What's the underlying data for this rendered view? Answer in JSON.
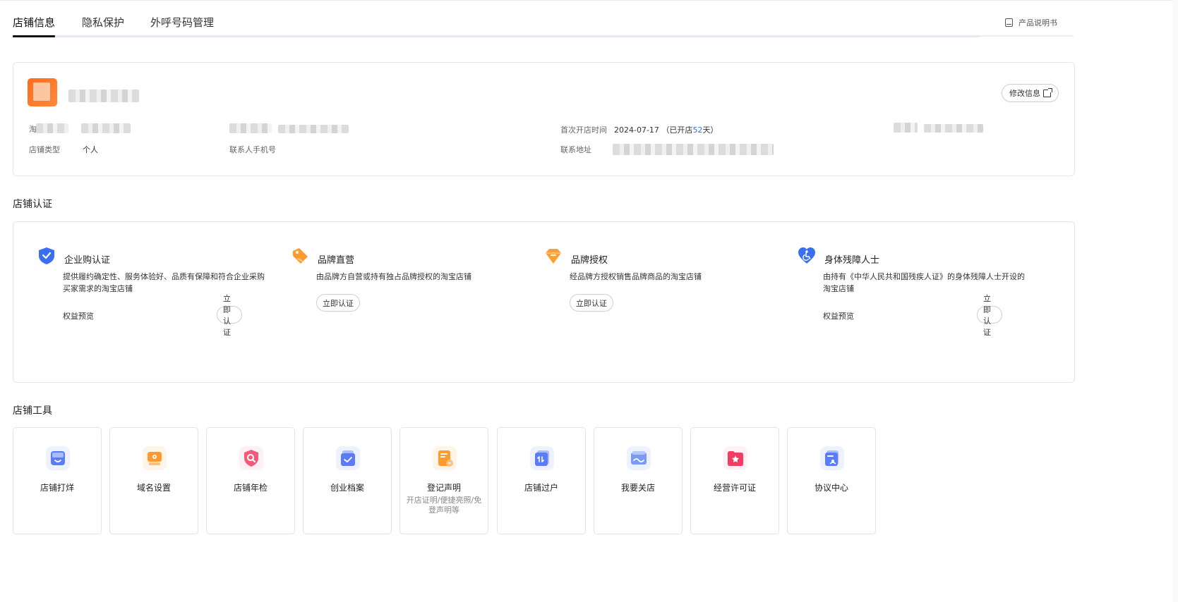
{
  "tabs": [
    {
      "label": "店铺信息",
      "active": true
    },
    {
      "label": "隐私保护",
      "active": false
    },
    {
      "label": "外呼号码管理",
      "active": false
    }
  ],
  "manual_link": "产品说明书",
  "shop_info": {
    "edit_button": "修改信息",
    "first_open_label": "首次开店时间",
    "first_open_date": "2024-07-17",
    "open_prefix": "（已开店",
    "open_days": "52",
    "open_suffix": "天）",
    "shop_type_label": "店铺类型",
    "shop_type_value": "个人",
    "contact_phone_label": "联系人手机号",
    "address_label": "联系地址",
    "partial_label": "淘"
  },
  "cert_section_title": "店铺认证",
  "certs": [
    {
      "title": "企业购认证",
      "desc": "提供履约确定性、服务体验好、品质有保障和符合企业采购买家需求的淘宝店铺",
      "benefit": "权益预览",
      "button": "立即认证",
      "icon": "shield-check-icon"
    },
    {
      "title": "品牌直营",
      "desc": "由品牌方自营或持有独占品牌授权的淘宝店铺",
      "button": "立即认证",
      "icon": "price-tag-icon"
    },
    {
      "title": "品牌授权",
      "desc": "经品牌方授权销售品牌商品的淘宝店铺",
      "button": "立即认证",
      "icon": "diamond-icon"
    },
    {
      "title": "身体残障人士",
      "desc": "由持有《中华人民共和国残疾人证》的身体残障人士开设的淘宝店铺",
      "benefit": "权益预览",
      "button": "立即认证",
      "icon": "heart-wheelchair-icon"
    }
  ],
  "tools_section_title": "店铺工具",
  "tools": [
    {
      "label": "店铺打烊",
      "icon": "store-closed-icon",
      "color": "#5b7cf6"
    },
    {
      "label": "域名设置",
      "icon": "domain-settings-icon",
      "color": "#ff9a2e"
    },
    {
      "label": "店铺年检",
      "icon": "shield-search-icon",
      "color": "#f25a7a"
    },
    {
      "label": "创业档案",
      "icon": "archive-icon",
      "color": "#5b7cf6"
    },
    {
      "label": "登记声明",
      "sub": "开店证明/便捷亮照/免登声明等",
      "icon": "statement-icon",
      "color": "#ff9a2e"
    },
    {
      "label": "店铺过户",
      "icon": "transfer-icon",
      "color": "#5b7cf6"
    },
    {
      "label": "我要关店",
      "icon": "close-store-icon",
      "color": "#7b9af8"
    },
    {
      "label": "经营许可证",
      "icon": "license-folder-icon",
      "color": "#f23d63"
    },
    {
      "label": "协议中心",
      "icon": "agreement-icon",
      "color": "#5b7cf6"
    }
  ]
}
